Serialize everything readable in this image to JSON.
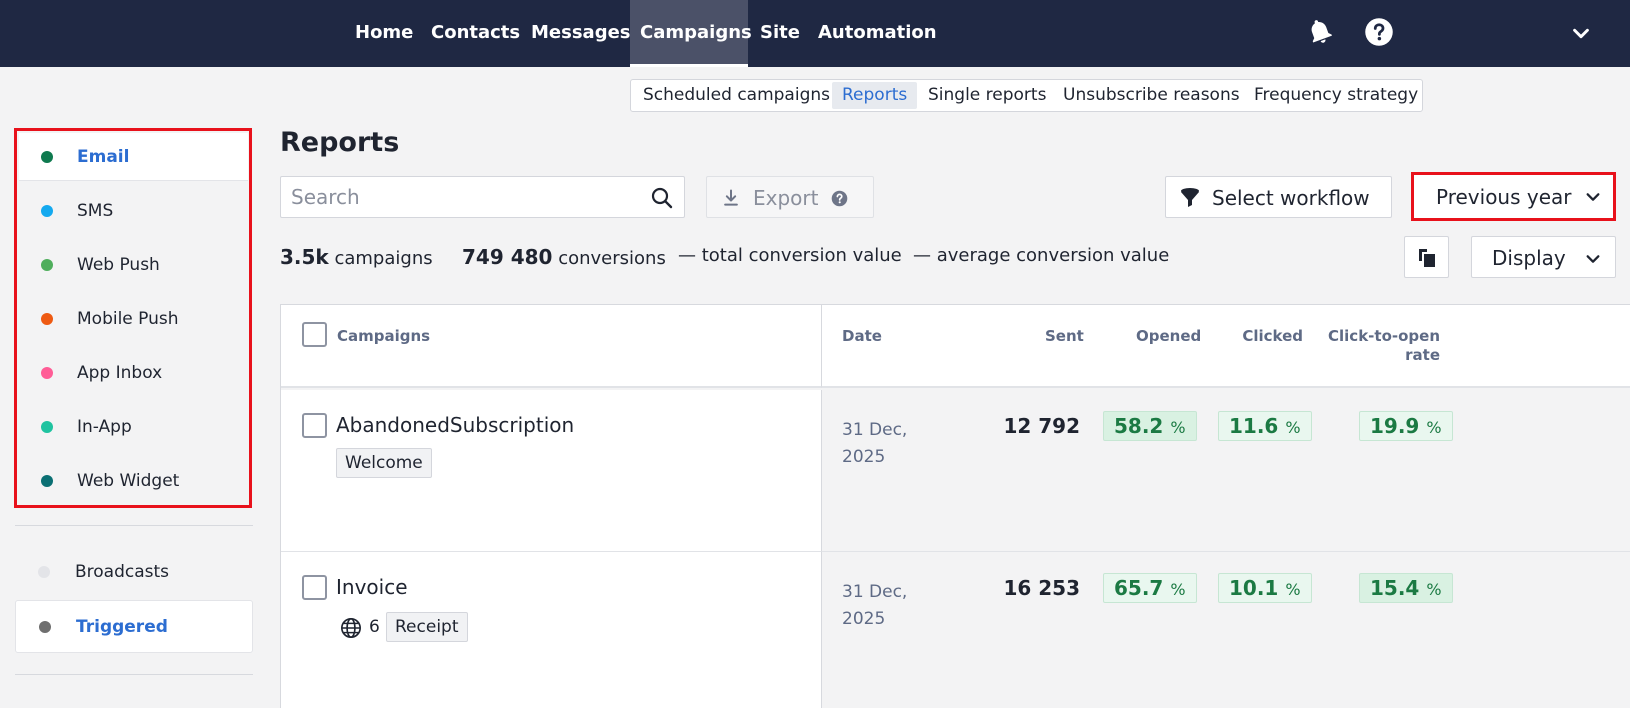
{
  "nav": {
    "items": [
      "Home",
      "Contacts",
      "Messages",
      "Campaigns",
      "Site",
      "Automation"
    ],
    "active": "Campaigns",
    "icons": [
      "bell-icon",
      "help-icon",
      "chevron-down-icon"
    ]
  },
  "subtabs": {
    "items": [
      "Scheduled campaigns",
      "Reports",
      "Single reports",
      "Unsubscribe reasons",
      "Frequency strategy"
    ],
    "active": "Reports"
  },
  "sidebar": {
    "channels": [
      {
        "label": "Email",
        "color": "#0f7a4f",
        "active": true
      },
      {
        "label": "SMS",
        "color": "#14a9ef",
        "active": false
      },
      {
        "label": "Web Push",
        "color": "#4fae5c",
        "active": false
      },
      {
        "label": "Mobile Push",
        "color": "#ee5a12",
        "active": false
      },
      {
        "label": "App Inbox",
        "color": "#ff5c96",
        "active": false
      },
      {
        "label": "In-App",
        "color": "#1fc3a0",
        "active": false
      },
      {
        "label": "Web Widget",
        "color": "#0a6f73",
        "active": false
      }
    ],
    "types": [
      {
        "label": "Broadcasts",
        "color": "#e3e4e8",
        "active": false
      },
      {
        "label": "Triggered",
        "color": "#6f6f6f",
        "active": true
      }
    ]
  },
  "main": {
    "title": "Reports",
    "search_placeholder": "Search",
    "export_label": "Export",
    "select_workflow_label": "Select workflow",
    "period_label": "Previous year",
    "display_label": "Display",
    "stats": {
      "campaigns_value": "3.5k",
      "campaigns_label": "campaigns",
      "conversions_value": "749 480",
      "conversions_label": "conversions",
      "total_value_dash": "—",
      "total_value_label": "total conversion value",
      "avg_value_dash": "—",
      "avg_value_label": "average conversion value"
    }
  },
  "table": {
    "headers": {
      "campaigns": "Campaigns",
      "date": "Date",
      "sent": "Sent",
      "opened": "Opened",
      "clicked": "Clicked",
      "cto_line1": "Click-to-open",
      "cto_line2": "rate"
    },
    "rows": [
      {
        "name": "AbandonedSubscription",
        "tag": "Welcome",
        "languages": "",
        "date_line1": "31 Dec,",
        "date_line2": "2025",
        "sent": "12 792",
        "opened": "58.2",
        "clicked": "11.6",
        "cto": "19.9",
        "unit": "%"
      },
      {
        "name": "Invoice",
        "tag": "Receipt",
        "languages": "6",
        "date_line1": "31 Dec,",
        "date_line2": "2025",
        "sent": "16 253",
        "opened": "65.7",
        "clicked": "10.1",
        "cto": "15.4",
        "unit": "%"
      }
    ]
  }
}
